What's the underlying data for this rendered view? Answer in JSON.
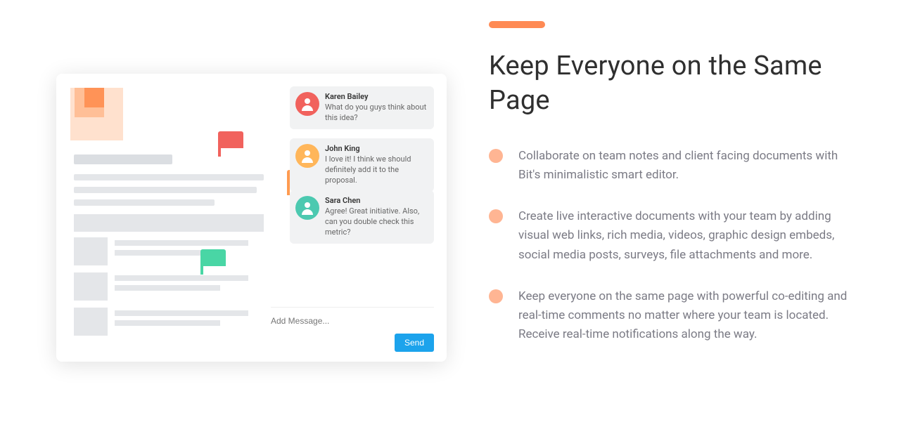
{
  "heading": "Keep Everyone on the Same Page",
  "bullets": [
    "Collaborate on team notes and client facing documents with Bit's minimalistic smart editor.",
    "Create live interactive documents with your team by adding visual web links, rich media, videos, graphic design embeds, social media posts, surveys, file attachments and more.",
    "Keep everyone on the same page with powerful co-editing and real-time comments no matter where your team is located. Receive real-time notifications along the way."
  ],
  "chat": [
    {
      "name": "Karen Bailey",
      "msg": "What do you guys think about this idea?"
    },
    {
      "name": "John King",
      "msg": "I love it! I think we should definitely add it to the proposal."
    },
    {
      "name": "Sara Chen",
      "msg": "Agree! Great initiative. Also, can you double check this metric?"
    }
  ],
  "input_placeholder": "Add Message...",
  "send_label": "Send"
}
